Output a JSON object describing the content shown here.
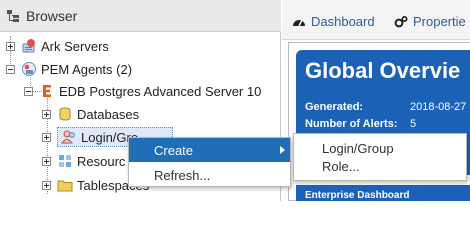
{
  "browser": {
    "title": "Browser",
    "tree": [
      {
        "key": "ark",
        "label": "Ark Servers"
      },
      {
        "key": "pem",
        "label": "PEM Agents (2)"
      },
      {
        "key": "edb",
        "label": "EDB Postgres Advanced Server 10"
      },
      {
        "key": "databases",
        "label": "Databases"
      },
      {
        "key": "login",
        "label": "Login/Gro"
      },
      {
        "key": "resource",
        "label": "Resourc"
      },
      {
        "key": "tablespaces",
        "label": "Tablespaces"
      }
    ]
  },
  "tabs": [
    {
      "label": "Dashboard"
    },
    {
      "label": "Propertie"
    }
  ],
  "dashboard": {
    "title": "Global Overvie",
    "fields": [
      {
        "label": "Generated:",
        "value": "2018-08-27"
      },
      {
        "label": "Number of Alerts:",
        "value": "5"
      }
    ],
    "section_title": "Enterprise Dashboard"
  },
  "context_menu": {
    "items": [
      {
        "label": "Create",
        "has_submenu": true
      },
      {
        "label": "Refresh..."
      }
    ],
    "submenu": [
      {
        "label": "Login/Group"
      },
      {
        "label": "Role..."
      }
    ]
  },
  "colors": {
    "accent_blue": "#1b62b6",
    "menu_highlight": "#1f6fb8",
    "tab_text": "#2c5c9c",
    "edb_logo": "#e35d1f"
  }
}
